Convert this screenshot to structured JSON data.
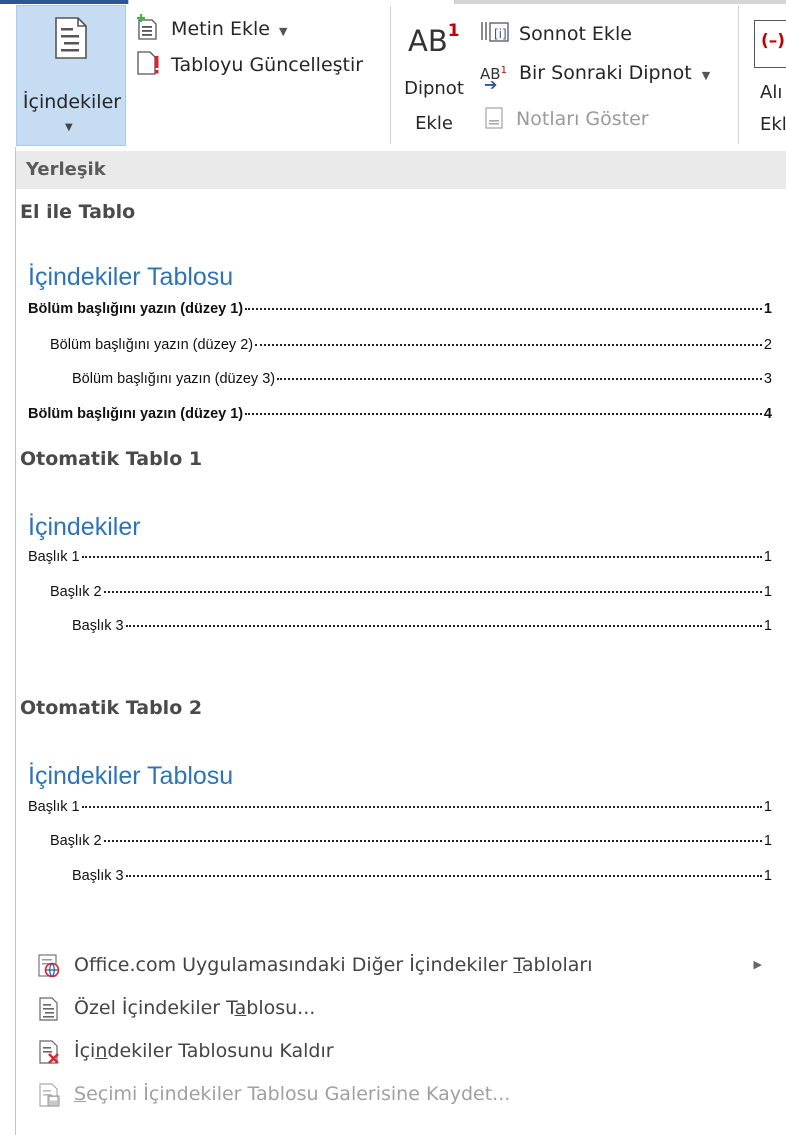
{
  "ribbon": {
    "toc_button": {
      "label": "İçindekiler"
    },
    "add_text": {
      "label": "Metin Ekle"
    },
    "update_table": {
      "label": "Tabloyu Güncelleştir"
    },
    "footnote_big": {
      "glyph": "AB",
      "superscript": "1",
      "label_line1": "Dipnot",
      "label_line2": "Ekle"
    },
    "insert_endnote": {
      "label": "Sonnot Ekle"
    },
    "next_footnote": {
      "label": "Bir Sonraki Dipnot"
    },
    "show_notes": {
      "label": "Notları Göster"
    },
    "cut_off_label_line1": "Alı",
    "cut_off_label_line2": "Ekl"
  },
  "dropdown": {
    "gallery_header": "Yerleşik",
    "sections": [
      {
        "name": "El ile Tablo",
        "toc_title": "İçindekiler Tablosu",
        "entries": [
          {
            "text": "Bölüm başlığını yazın (düzey 1)",
            "page": "1",
            "level": 1
          },
          {
            "text": "Bölüm başlığını yazın (düzey 2)",
            "page": "2",
            "level": 2
          },
          {
            "text": "Bölüm başlığını yazın (düzey 3)",
            "page": "3",
            "level": 3
          },
          {
            "text": "Bölüm başlığını yazın (düzey 1)",
            "page": "4",
            "level": 1
          }
        ]
      },
      {
        "name": "Otomatik Tablo 1",
        "toc_title": "İçindekiler",
        "entries": [
          {
            "text": "Başlık 1",
            "page": "1",
            "level": 1
          },
          {
            "text": "Başlık 2",
            "page": "1",
            "level": 2
          },
          {
            "text": "Başlık 3",
            "page": "1",
            "level": 3
          }
        ]
      },
      {
        "name": "Otomatik Tablo 2",
        "toc_title": "İçindekiler Tablosu",
        "entries": [
          {
            "text": "Başlık 1",
            "page": "1",
            "level": 1
          },
          {
            "text": "Başlık 2",
            "page": "1",
            "level": 2
          },
          {
            "text": "Başlık 3",
            "page": "1",
            "level": 3
          }
        ]
      }
    ],
    "menu": [
      {
        "label_before": "Office.com Uygulamasındaki Diğer İçindekiler ",
        "label_u": "T",
        "label_after": "abloları",
        "submenu": true,
        "enabled": true
      },
      {
        "label_before": "Özel İçindekiler T",
        "label_u": "a",
        "label_after": "blosu...",
        "submenu": false,
        "enabled": true
      },
      {
        "label_before": "İçi",
        "label_u": "n",
        "label_after": "dekiler Tablosunu Kaldır",
        "submenu": false,
        "enabled": true
      },
      {
        "label_before": "",
        "label_u": "S",
        "label_after": "eçimi İçindekiler Tablosu Galerisine Kaydet...",
        "submenu": false,
        "enabled": false
      }
    ]
  },
  "colors": {
    "accent": "#2b579a",
    "toc_title": "#2e74b5",
    "selected_button": "#c5dcf3",
    "endnote_marker": "#c00000"
  }
}
